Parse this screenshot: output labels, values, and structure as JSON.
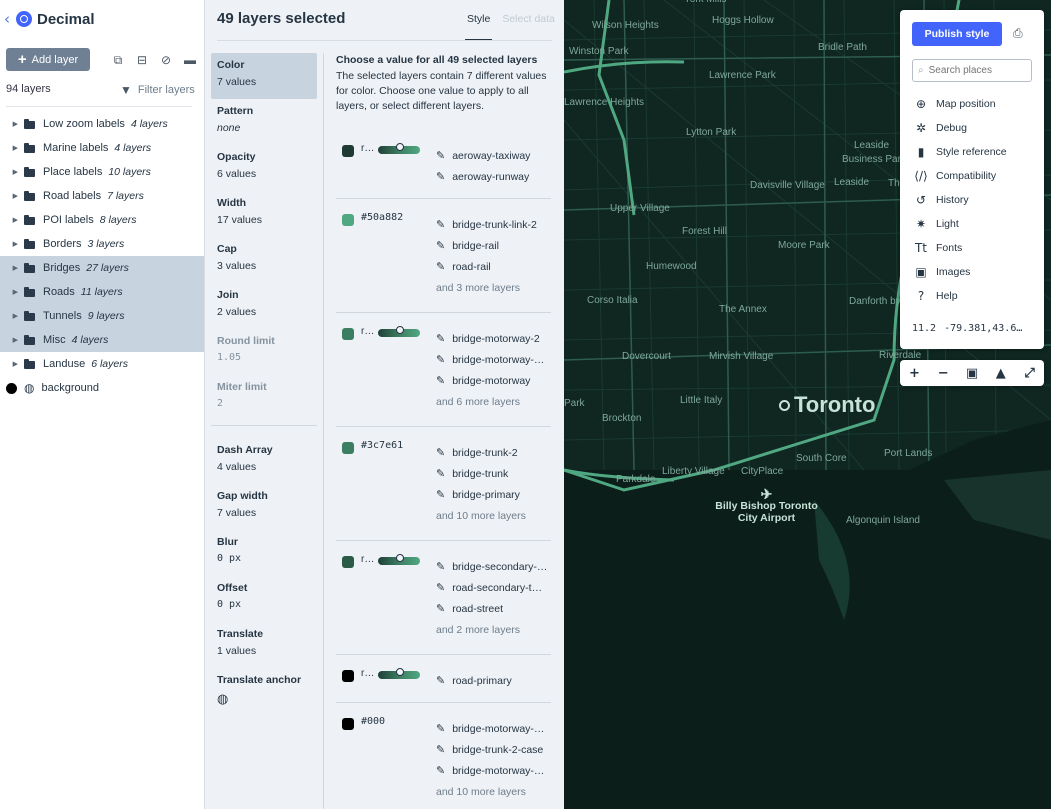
{
  "app": {
    "name": "Decimal"
  },
  "toolbar": {
    "add_layer": "Add layer",
    "layer_count": "94 layers",
    "filter": "Filter layers"
  },
  "tree": [
    {
      "label": "Low zoom labels",
      "count": "4 layers",
      "selected": false
    },
    {
      "label": "Marine labels",
      "count": "4 layers",
      "selected": false
    },
    {
      "label": "Place labels",
      "count": "10 layers",
      "selected": false
    },
    {
      "label": "Road labels",
      "count": "7 layers",
      "selected": false
    },
    {
      "label": "POI labels",
      "count": "8 layers",
      "selected": false
    },
    {
      "label": "Borders",
      "count": "3 layers",
      "selected": false
    },
    {
      "label": "Bridges",
      "count": "27 layers",
      "selected": true
    },
    {
      "label": "Roads",
      "count": "11 layers",
      "selected": true
    },
    {
      "label": "Tunnels",
      "count": "9 layers",
      "selected": true
    },
    {
      "label": "Misc",
      "count": "4 layers",
      "selected": true
    },
    {
      "label": "Landuse",
      "count": "6 layers",
      "selected": false
    }
  ],
  "background_layer": "background",
  "panel": {
    "title": "49 layers selected",
    "tab_style": "Style",
    "tab_data": "Select data",
    "choose_heading": "Choose a value for all 49 selected layers",
    "choose_desc": "The selected layers contain 7 different values for color. Choose one value to apply to all layers, or select different layers."
  },
  "properties": [
    {
      "label": "Color",
      "value": "7 values"
    },
    {
      "label": "Pattern",
      "value": "none"
    },
    {
      "label": "Opacity",
      "value": "6 values"
    },
    {
      "label": "Width",
      "value": "17 values"
    },
    {
      "label": "Cap",
      "value": "3 values"
    },
    {
      "label": "Join",
      "value": "2 values"
    },
    {
      "label": "Round limit",
      "value": "1.05"
    },
    {
      "label": "Miter limit",
      "value": "2"
    },
    {
      "label": "Dash Array",
      "value": "4 values"
    },
    {
      "label": "Gap width",
      "value": "7 values"
    },
    {
      "label": "Blur",
      "value": "0 px"
    },
    {
      "label": "Offset",
      "value": "0 px"
    },
    {
      "label": "Translate",
      "value": "1 values"
    },
    {
      "label": "Translate anchor",
      "value": ""
    }
  ],
  "groups": [
    {
      "value": "r…",
      "swatch": "#1f3a33",
      "items": [
        "aeroway-taxiway",
        "aeroway-runway"
      ],
      "more": ""
    },
    {
      "value": "#50a882",
      "swatch": "#50a882",
      "items": [
        "bridge-trunk-link-2",
        "bridge-rail",
        "road-rail"
      ],
      "more": "and 3 more layers"
    },
    {
      "value": "r…",
      "swatch": "#3c7e61",
      "items": [
        "bridge-motorway-2",
        "bridge-motorway-…",
        "bridge-motorway"
      ],
      "more": "and 6 more layers"
    },
    {
      "value": "#3c7e61",
      "swatch": "#3c7e61",
      "items": [
        "bridge-trunk-2",
        "bridge-trunk",
        "bridge-primary"
      ],
      "more": "and 10 more layers"
    },
    {
      "value": "r…",
      "swatch": "#2b5a47",
      "items": [
        "bridge-secondary-…",
        "road-secondary-t…",
        "road-street"
      ],
      "more": "and 2 more layers"
    },
    {
      "value": "r…",
      "swatch": "#000000",
      "items": [
        "road-primary"
      ],
      "more": ""
    },
    {
      "value": "#000",
      "swatch": "#000000",
      "items": [
        "bridge-motorway-…",
        "bridge-trunk-2-case",
        "bridge-motorway-…"
      ],
      "more": "and 10 more layers"
    }
  ],
  "map": {
    "city": "Toronto",
    "airport": "Billy Bishop Toronto City Airport",
    "labels": [
      "York Mills",
      "Wilson Heights",
      "Hoggs Hollow",
      "Bridle Path",
      "Winston Park",
      "Lawrence Park",
      "Lawrence Heights",
      "Lytton Park",
      "Leaside",
      "Business Park",
      "Davisville Village",
      "Leaside",
      "Th",
      "Upper Village",
      "Forest Hill",
      "Moore Park",
      "Humewood",
      "Corso Italia",
      "The Annex",
      "Danforth by the Valley",
      "Dovercourt",
      "Mirvish Village",
      "Riverdale",
      "Park",
      "Little Italy",
      "Brockton",
      "South Core",
      "Port Lands",
      "Liberty Village",
      "CityPlace",
      "Parkdale",
      "Algonquin Island"
    ]
  },
  "map_panel": {
    "publish": "Publish style",
    "search_placeholder": "Search places",
    "menu": [
      "Map position",
      "Debug",
      "Style reference",
      "Compatibility",
      "History",
      "Light",
      "Fonts",
      "Images",
      "Help"
    ],
    "zoom": "11.2",
    "coords": "-79.381,43.6…"
  }
}
